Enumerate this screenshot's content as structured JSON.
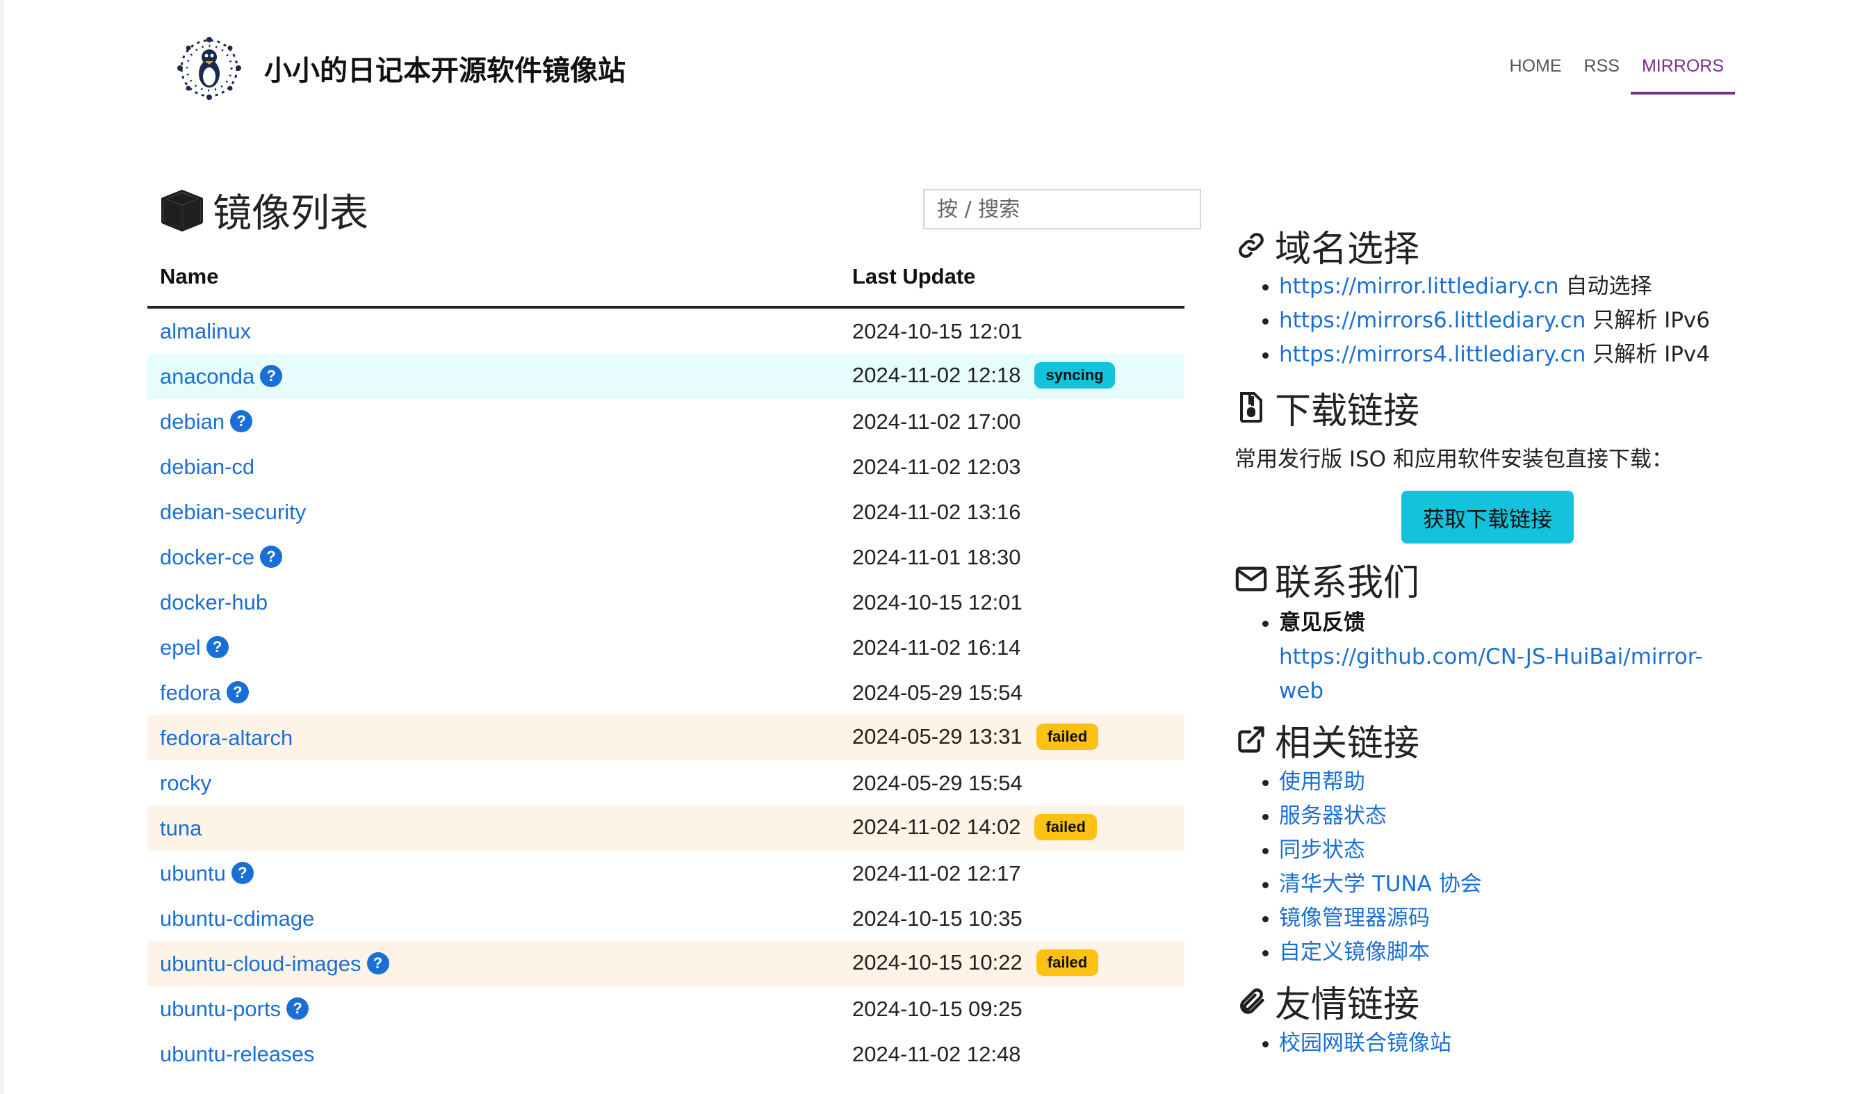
{
  "header": {
    "site_title": "小小的日记本开源软件镜像站",
    "nav": [
      {
        "label": "HOME",
        "active": false
      },
      {
        "label": "RSS",
        "active": false
      },
      {
        "label": "MIRRORS",
        "active": true
      }
    ]
  },
  "mirror_list": {
    "title": "镜像列表",
    "search_placeholder": "按 / 搜索",
    "columns": {
      "name": "Name",
      "last_update": "Last Update"
    },
    "rows": [
      {
        "name": "almalinux",
        "help": false,
        "time": "2024-10-15 12:01",
        "status": ""
      },
      {
        "name": "anaconda",
        "help": true,
        "time": "2024-11-02 12:18",
        "status": "syncing"
      },
      {
        "name": "debian",
        "help": true,
        "time": "2024-11-02 17:00",
        "status": ""
      },
      {
        "name": "debian-cd",
        "help": false,
        "time": "2024-11-02 12:03",
        "status": ""
      },
      {
        "name": "debian-security",
        "help": false,
        "time": "2024-11-02 13:16",
        "status": ""
      },
      {
        "name": "docker-ce",
        "help": true,
        "time": "2024-11-01 18:30",
        "status": ""
      },
      {
        "name": "docker-hub",
        "help": false,
        "time": "2024-10-15 12:01",
        "status": ""
      },
      {
        "name": "epel",
        "help": true,
        "time": "2024-11-02 16:14",
        "status": ""
      },
      {
        "name": "fedora",
        "help": true,
        "time": "2024-05-29 15:54",
        "status": ""
      },
      {
        "name": "fedora-altarch",
        "help": false,
        "time": "2024-05-29 13:31",
        "status": "failed"
      },
      {
        "name": "rocky",
        "help": false,
        "time": "2024-05-29 15:54",
        "status": ""
      },
      {
        "name": "tuna",
        "help": false,
        "time": "2024-11-02 14:02",
        "status": "failed"
      },
      {
        "name": "ubuntu",
        "help": true,
        "time": "2024-11-02 12:17",
        "status": ""
      },
      {
        "name": "ubuntu-cdimage",
        "help": false,
        "time": "2024-10-15 10:35",
        "status": ""
      },
      {
        "name": "ubuntu-cloud-images",
        "help": true,
        "time": "2024-10-15 10:22",
        "status": "failed"
      },
      {
        "name": "ubuntu-ports",
        "help": true,
        "time": "2024-10-15 09:25",
        "status": ""
      },
      {
        "name": "ubuntu-releases",
        "help": false,
        "time": "2024-11-02 12:48",
        "status": ""
      }
    ]
  },
  "sidebar": {
    "domain": {
      "title": "域名选择",
      "items": [
        {
          "url": "https://mirror.littlediary.cn",
          "note": "自动选择"
        },
        {
          "url": "https://mirrors6.littlediary.cn",
          "note": "只解析 IPv6"
        },
        {
          "url": "https://mirrors4.littlediary.cn",
          "note": "只解析 IPv4"
        }
      ]
    },
    "download": {
      "title": "下载链接",
      "desc": "常用发行版 ISO 和应用软件安装包直接下载：",
      "button": "获取下载链接"
    },
    "contact": {
      "title": "联系我们",
      "feedback_label": "意见反馈",
      "feedback_url": "https://github.com/CN-JS-HuiBai/mirror-web"
    },
    "related": {
      "title": "相关链接",
      "items": [
        "使用帮助",
        "服务器状态",
        "同步状态",
        "清华大学 TUNA 协会",
        "镜像管理器源码",
        "自定义镜像脚本"
      ]
    },
    "friends": {
      "title": "友情链接",
      "items": [
        "校园网联合镜像站"
      ]
    }
  },
  "colors": {
    "link": "#1a6fd6",
    "accent": "#7b2d8e",
    "syncing": "#13c2dc",
    "failed": "#fcc112"
  },
  "icons": [
    "tux-logo-icon",
    "box-icon",
    "link-icon",
    "file-zip-icon",
    "envelope-icon",
    "external-link-icon",
    "paperclip-icon",
    "help-icon"
  ]
}
